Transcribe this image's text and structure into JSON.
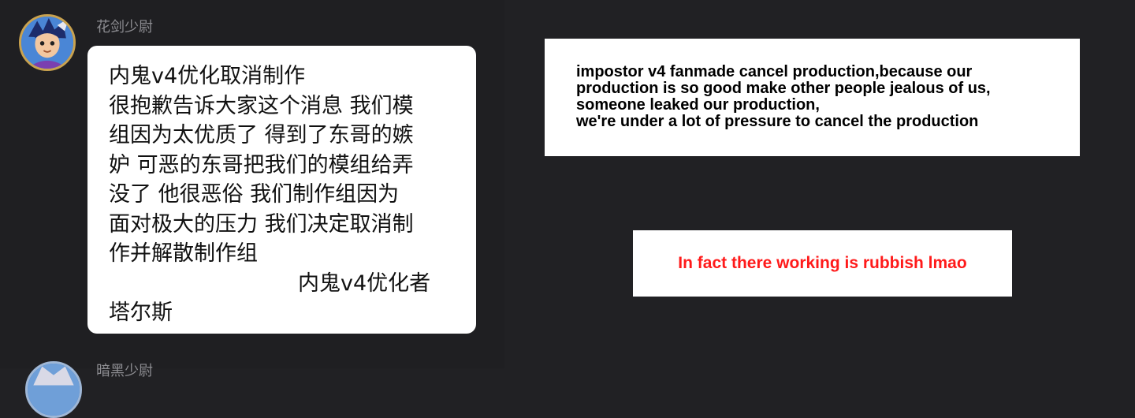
{
  "messages": [
    {
      "username": "花剑少尉",
      "avatar_icon": "cartoon-character-avatar-icon",
      "lines": [
        "内鬼v4优化取消制作",
        "很抱歉告诉大家这个消息 我们模",
        "组因为太优质了 得到了东哥的嫉",
        "妒 可恶的东哥把我们的模组给弄",
        "没了 他很恶俗 我们制作组因为",
        "面对极大的压力 我们决定取消制",
        "作并解散制作组"
      ],
      "signature": "内鬼v4优化者",
      "signature_name": "塔尔斯"
    },
    {
      "username": "暗黑少尉",
      "avatar_icon": "cartoon-character-avatar-icon"
    }
  ],
  "translation": {
    "lines": [
      "impostor v4 fanmade cancel production,because our",
      "production is so good make other people jealous of us,",
      "someone leaked our production,",
      "we're under a lot of pressure to cancel the production"
    ]
  },
  "comment": {
    "text": "In fact there working is rubbish lmao",
    "color": "#ff1a1a"
  },
  "colors": {
    "background": "#212124",
    "bubble": "#ffffff",
    "username": "#8d8d92",
    "avatar_border": "#c9a24f"
  }
}
